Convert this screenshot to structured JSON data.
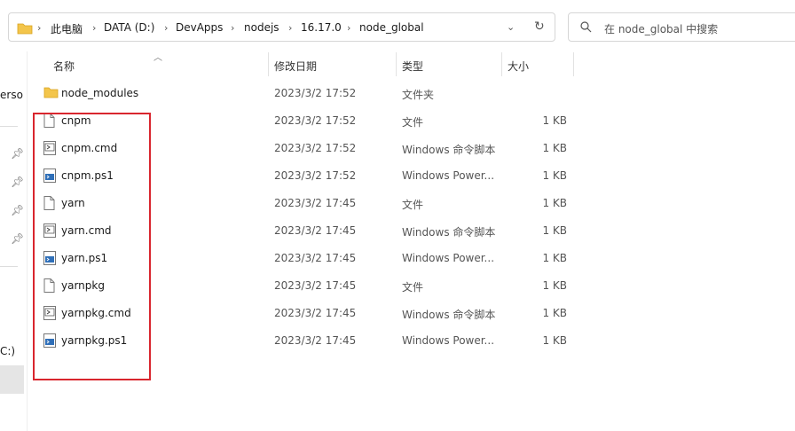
{
  "address_bar": {
    "breadcrumbs": [
      "此电脑",
      "DATA (D:)",
      "DevApps",
      "nodejs",
      "16.17.0",
      "node_global"
    ],
    "separator": "›"
  },
  "search": {
    "placeholder": "在 node_global 中搜索"
  },
  "nav_fragments": {
    "item_text": "erso",
    "drive_text": "C:)"
  },
  "columns": {
    "name": "名称",
    "date": "修改日期",
    "type": "类型",
    "size": "大小"
  },
  "files": [
    {
      "name": "node_modules",
      "date": "2023/3/2 17:52",
      "type": "文件夹",
      "size": "",
      "icon": "folder-icon"
    },
    {
      "name": "cnpm",
      "date": "2023/3/2 17:52",
      "type": "文件",
      "size": "1 KB",
      "icon": "file-icon"
    },
    {
      "name": "cnpm.cmd",
      "date": "2023/3/2 17:52",
      "type": "Windows 命令脚本",
      "size": "1 KB",
      "icon": "cmd-file-icon"
    },
    {
      "name": "cnpm.ps1",
      "date": "2023/3/2 17:52",
      "type": "Windows Power...",
      "size": "1 KB",
      "icon": "powershell-file-icon"
    },
    {
      "name": "yarn",
      "date": "2023/3/2 17:45",
      "type": "文件",
      "size": "1 KB",
      "icon": "file-icon"
    },
    {
      "name": "yarn.cmd",
      "date": "2023/3/2 17:45",
      "type": "Windows 命令脚本",
      "size": "1 KB",
      "icon": "cmd-file-icon"
    },
    {
      "name": "yarn.ps1",
      "date": "2023/3/2 17:45",
      "type": "Windows Power...",
      "size": "1 KB",
      "icon": "powershell-file-icon"
    },
    {
      "name": "yarnpkg",
      "date": "2023/3/2 17:45",
      "type": "文件",
      "size": "1 KB",
      "icon": "file-icon"
    },
    {
      "name": "yarnpkg.cmd",
      "date": "2023/3/2 17:45",
      "type": "Windows 命令脚本",
      "size": "1 KB",
      "icon": "cmd-file-icon"
    },
    {
      "name": "yarnpkg.ps1",
      "date": "2023/3/2 17:45",
      "type": "Windows Power...",
      "size": "1 KB",
      "icon": "powershell-file-icon"
    }
  ],
  "colors": {
    "highlight": "#d9262e",
    "folder": "#f3c54b"
  }
}
